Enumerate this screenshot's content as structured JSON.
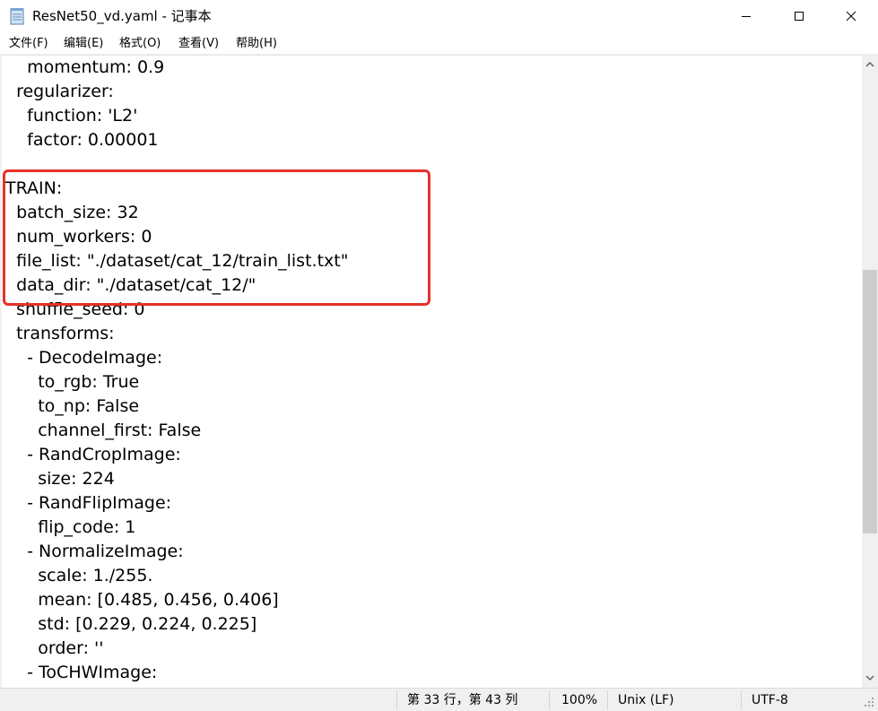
{
  "window": {
    "title": "ResNet50_vd.yaml - 记事本",
    "minimize_glyph": "—",
    "maximize_glyph": "☐",
    "close_glyph": "✕"
  },
  "menu": {
    "items": [
      {
        "label": "文件(F)"
      },
      {
        "label": "编辑(E)"
      },
      {
        "label": "格式(O)"
      },
      {
        "label": "查看(V)"
      },
      {
        "label": "帮助(H)"
      }
    ]
  },
  "editor": {
    "lines": [
      "    momentum: 0.9",
      "  regularizer:",
      "    function: 'L2'",
      "    factor: 0.00001",
      "",
      "TRAIN:",
      "  batch_size: 32",
      "  num_workers: 0",
      "  file_list: \"./dataset/cat_12/train_list.txt\"",
      "  data_dir: \"./dataset/cat_12/\"",
      "  shuffle_seed: 0",
      "  transforms:",
      "    - DecodeImage:",
      "      to_rgb: True",
      "      to_np: False",
      "      channel_first: False",
      "    - RandCropImage:",
      "      size: 224",
      "    - RandFlipImage:",
      "      flip_code: 1",
      "    - NormalizeImage:",
      "      scale: 1./255.",
      "      mean: [0.485, 0.456, 0.406]",
      "      std: [0.229, 0.224, 0.225]",
      "      order: ''",
      "    - ToCHWImage:"
    ],
    "highlight_color": "#e8302a"
  },
  "statusbar": {
    "position": "第 33 行，第 43 列",
    "zoom": "100%",
    "line_ending": "Unix (LF)",
    "encoding": "UTF-8"
  },
  "icons": {
    "app": "notepad-icon",
    "scroll_up": "arrow-up-icon",
    "scroll_down": "arrow-down-icon",
    "grip": "resize-grip-icon"
  }
}
